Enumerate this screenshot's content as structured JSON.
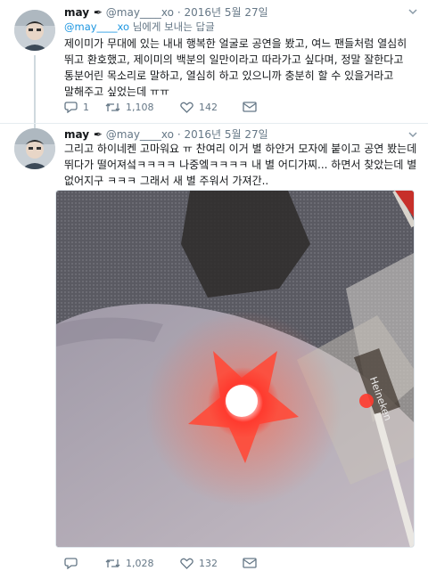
{
  "tweets": [
    {
      "display_name": "may",
      "name_icon": "pen-icon",
      "handle": "@may____xo",
      "separator": "·",
      "date": "2016년 5월 27일",
      "reply_to_handle": "@may____xo",
      "reply_to_suffix": " 님에게 보내는 답글",
      "text": "제이미가 무대에 있는 내내 행복한 얼굴로 공연을 봤고, 여느 팬들처럼 열심히 뛰고 환호했고, 제이미의 백분의 일만이라고 따라가고 싶다며, 정말 잘한다고 통분어린 목소리로 말하고, 열심히 하고 있으니까 충분히 할 수 있을거라고 말해주고 싶었는데 ㅠㅠ",
      "actions": {
        "reply": "1",
        "retweet": "1,108",
        "like": "142"
      }
    },
    {
      "display_name": "may",
      "name_icon": "pen-icon",
      "handle": "@may____xo",
      "separator": "·",
      "date": "2016년 5월 27일",
      "text": "그리고 하이네켄 고마워요 ㅠ 찬여리 이거 별 하얀거 모자에 붙이고 공연 봤는데 뛰다가 떨어져섴ㅋㅋㅋㅋ 나중엨ㅋㅋㅋㅋ 내 별 어디가찌... 하면서 찾았는데 별 없어지구 ㅋㅋㅋ 그래서 새 별 주워서 가져간..",
      "photo_description": "glowing-red-star-on-hand",
      "actions": {
        "reply": "",
        "retweet": "1,028",
        "like": "132"
      }
    }
  ],
  "colors": {
    "link": "#1b95e0",
    "muted": "#657786",
    "text": "#14171a",
    "thread_line": "#cfd9de",
    "star_glow": "#ff3a2e"
  }
}
